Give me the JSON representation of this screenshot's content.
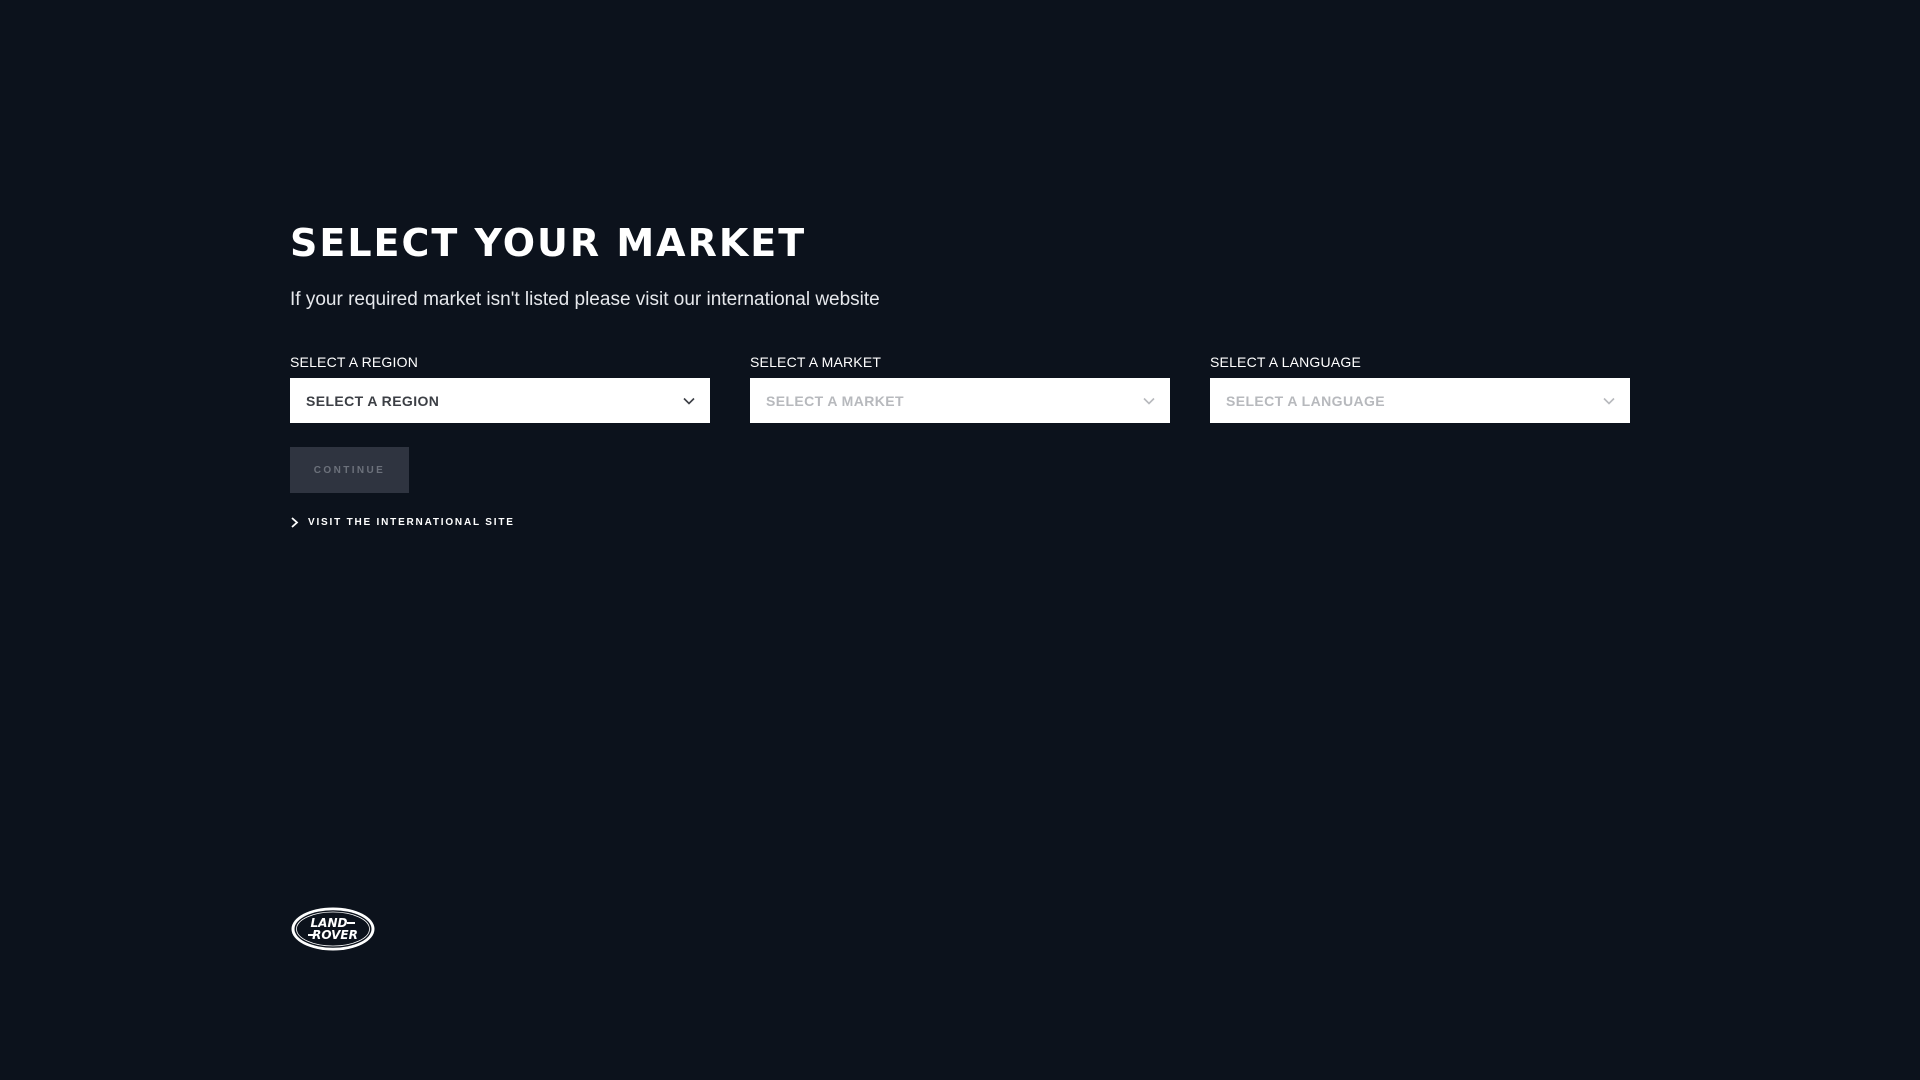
{
  "page": {
    "title": "SELECT YOUR MARKET",
    "subtitle": "If your required market isn't listed please visit our international website"
  },
  "selects": {
    "region": {
      "label": "SELECT A REGION",
      "value": "SELECT A REGION",
      "enabled": true
    },
    "market": {
      "label": "SELECT A MARKET",
      "value": "SELECT A MARKET",
      "enabled": false
    },
    "language": {
      "label": "SELECT A LANGUAGE",
      "value": "SELECT A LANGUAGE",
      "enabled": false
    }
  },
  "actions": {
    "continue_label": "CONTINUE",
    "international_link_label": "VISIT THE INTERNATIONAL SITE"
  },
  "logo": {
    "line1": "LAND",
    "line2": "ROVER",
    "icon": "land-rover-logo"
  },
  "colors": {
    "background": "#0c121c",
    "continue_disabled_bg": "#2f3440",
    "text_primary": "#ffffff"
  }
}
